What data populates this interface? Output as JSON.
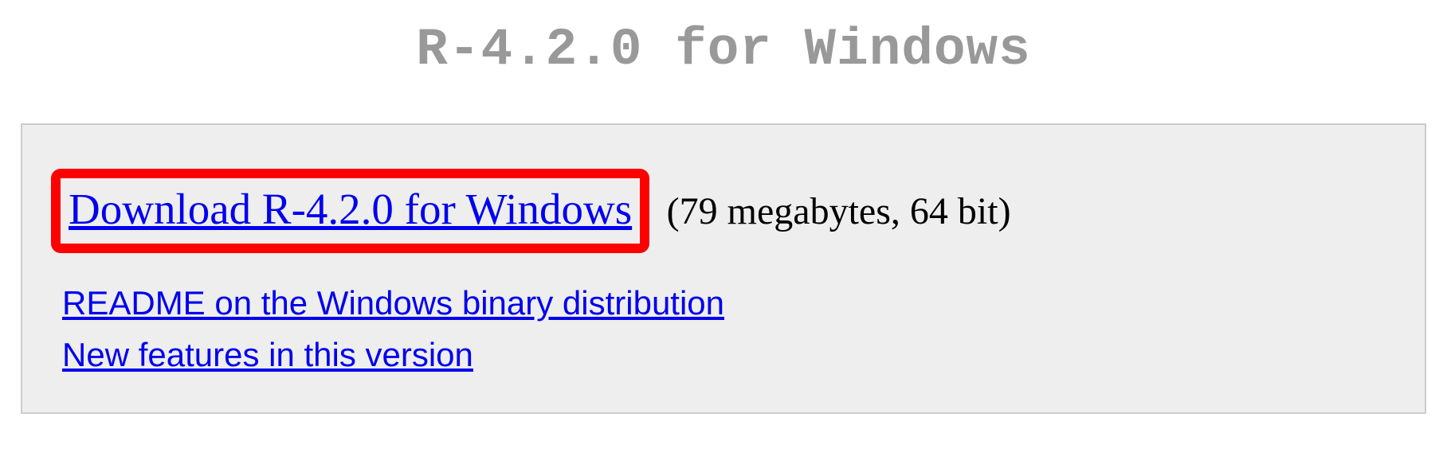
{
  "page": {
    "title": "R-4.2.0 for Windows"
  },
  "download": {
    "link_label": "Download R-4.2.0 for Windows",
    "meta": "(79 megabytes, 64 bit)"
  },
  "secondary_links": {
    "readme_label": "README on the Windows binary distribution",
    "features_label": "New features in this version"
  }
}
